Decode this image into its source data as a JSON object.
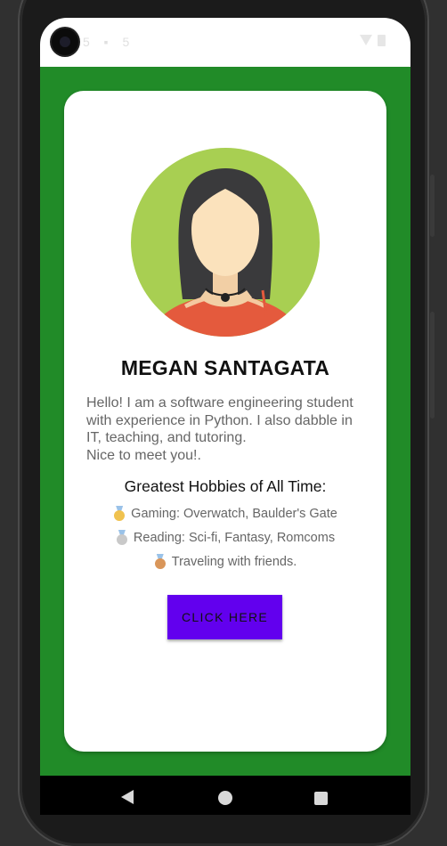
{
  "status_bar": {
    "left_text": "5 ▪ 5"
  },
  "profile": {
    "name": "MEGAN SANTAGATA",
    "bio": "Hello! I am a software engineering student with experience in Python. I also dabble in IT, teaching, and tutoring.\n Nice to meet you!."
  },
  "hobbies": {
    "title": "Greatest Hobbies of All Time:",
    "items": [
      {
        "icon": "gold-medal-icon",
        "text": "Gaming: Overwatch, Baulder's Gate",
        "color": "#f0c24f"
      },
      {
        "icon": "silver-medal-icon",
        "text": "Reading: Sci-fi, Fantasy, Romcoms",
        "color": "#c9c9c9"
      },
      {
        "icon": "bronze-medal-icon",
        "text": "Traveling with friends.",
        "color": "#d9965a"
      }
    ]
  },
  "cta": {
    "label": "CLICK HERE"
  },
  "colors": {
    "app_background": "#218b28",
    "card_background": "#ffffff",
    "button": "#6200ee",
    "avatar_circle": "#a8cf52"
  }
}
